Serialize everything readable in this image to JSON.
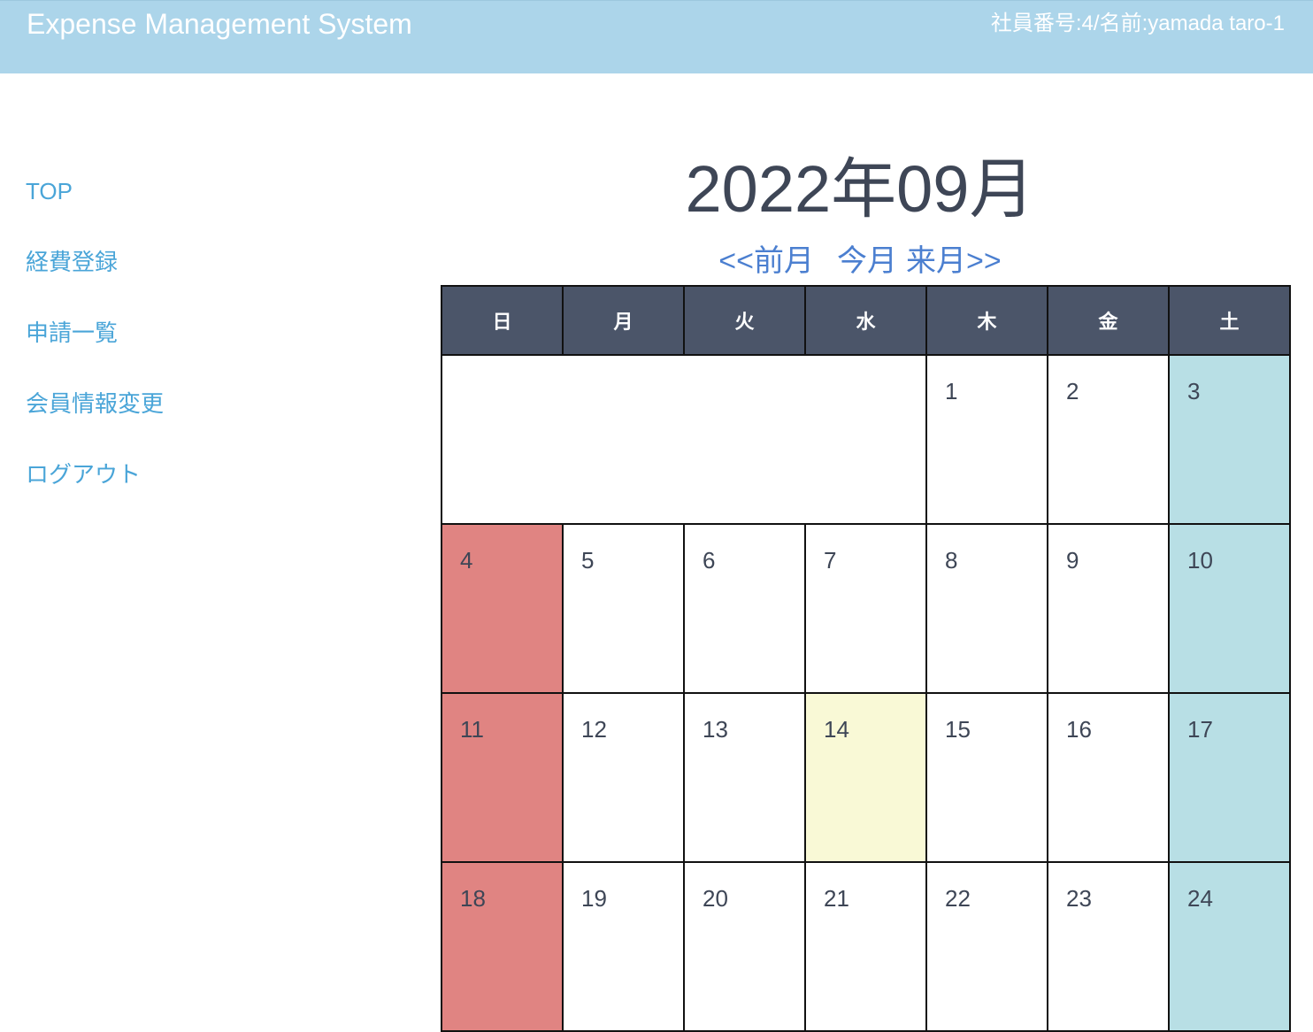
{
  "header": {
    "app_title": "Expense Management System",
    "user_info": "社員番号:4/名前:yamada taro-1",
    "background_color": "#acd5ea"
  },
  "sidebar": {
    "items": [
      {
        "label": "TOP"
      },
      {
        "label": "経費登録"
      },
      {
        "label": "申請一覧"
      },
      {
        "label": "会員情報変更"
      },
      {
        "label": "ログアウト"
      }
    ],
    "link_color": "#4aa5d8"
  },
  "calendar": {
    "title": "2022年09月",
    "nav": {
      "prev": "<<前月",
      "current": "今月",
      "next": "来月>>"
    },
    "weekdays": [
      "日",
      "月",
      "火",
      "水",
      "木",
      "金",
      "土"
    ],
    "weeks": [
      [
        "",
        "",
        "",
        "",
        "1",
        "2",
        "3"
      ],
      [
        "4",
        "5",
        "6",
        "7",
        "8",
        "9",
        "10"
      ],
      [
        "11",
        "12",
        "13",
        "14",
        "15",
        "16",
        "17"
      ],
      [
        "18",
        "19",
        "20",
        "21",
        "22",
        "23",
        "24"
      ]
    ],
    "today": "14",
    "colors": {
      "header": "#4b5569",
      "sunday": "#e08482",
      "saturday": "#b8dfe5",
      "today": "#f9f9d6"
    }
  }
}
